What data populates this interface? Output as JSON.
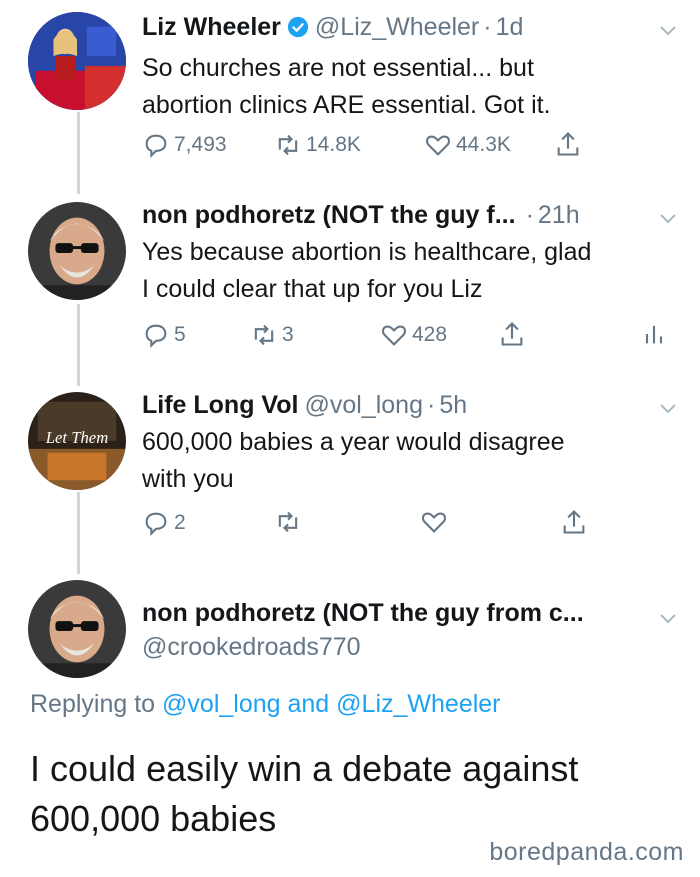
{
  "tweets": [
    {
      "name": "Liz Wheeler",
      "handle": "@Liz_Wheeler",
      "dot": "·",
      "time": "1d",
      "text_lines": [
        "So churches are not essential... but",
        "abortion clinics ARE essential. Got it."
      ],
      "replies": "7,493",
      "retweets": "14.8K",
      "likes": "44.3K"
    },
    {
      "name": "non podhoretz (NOT the guy f...",
      "dot": "·",
      "time": "21h",
      "text_lines": [
        "Yes because abortion is healthcare, glad",
        "I could clear that up for you Liz"
      ],
      "replies": "5",
      "retweets": "3",
      "likes": "428"
    },
    {
      "name": "Life Long Vol",
      "handle": "@vol_long",
      "dot": "·",
      "time": "5h",
      "text_lines": [
        "600,000 babies a year would disagree",
        "with you"
      ],
      "replies": "2",
      "avatar_text": "Let Them"
    }
  ],
  "focus": {
    "name": "non podhoretz (NOT the guy from c...",
    "handle": "@crookedroads770",
    "replying_prefix": "Replying to",
    "replying_user1": "@vol_long",
    "replying_and": "and",
    "replying_user2": "@Liz_Wheeler",
    "text_lines": [
      "I could easily win a debate against",
      "600,000 babies"
    ]
  },
  "watermark": "boredpanda.com",
  "colors": {
    "text": "#14171a",
    "muted": "#657786",
    "link": "#1da1f2",
    "line": "#ccd6dd"
  },
  "icons": [
    "verified-badge-icon",
    "chevron-down-icon",
    "reply-icon",
    "retweet-icon",
    "like-icon",
    "share-icon",
    "analytics-icon"
  ]
}
